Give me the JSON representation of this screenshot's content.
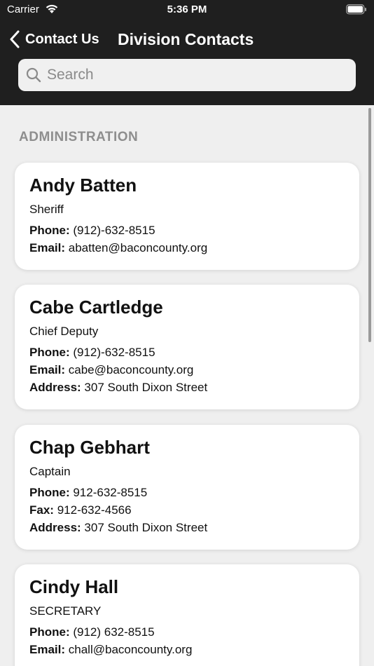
{
  "status_bar": {
    "carrier": "Carrier",
    "time": "5:36 PM"
  },
  "nav": {
    "back_label": "Contact Us",
    "title": "Division Contacts"
  },
  "search": {
    "placeholder": "Search"
  },
  "section": {
    "header": "ADMINISTRATION"
  },
  "contacts": [
    {
      "name": "Andy Batten",
      "title": "Sheriff",
      "fields": [
        {
          "label": "Phone:",
          "value": "(912)-632-8515"
        },
        {
          "label": "Email:",
          "value": "abatten@baconcounty.org"
        }
      ]
    },
    {
      "name": "Cabe Cartledge",
      "title": "Chief Deputy",
      "fields": [
        {
          "label": "Phone:",
          "value": "(912)-632-8515"
        },
        {
          "label": "Email:",
          "value": "cabe@baconcounty.org"
        },
        {
          "label": "Address:",
          "value": "307 South Dixon Street"
        }
      ]
    },
    {
      "name": "Chap Gebhart",
      "title": "Captain",
      "fields": [
        {
          "label": "Phone:",
          "value": "912-632-8515"
        },
        {
          "label": "Fax:",
          "value": "912-632-4566"
        },
        {
          "label": "Address:",
          "value": "307 South Dixon Street"
        }
      ]
    },
    {
      "name": "Cindy Hall",
      "title": "SECRETARY",
      "fields": [
        {
          "label": "Phone:",
          "value": "(912) 632-8515"
        },
        {
          "label": "Email:",
          "value": "chall@baconcounty.org"
        }
      ]
    }
  ]
}
